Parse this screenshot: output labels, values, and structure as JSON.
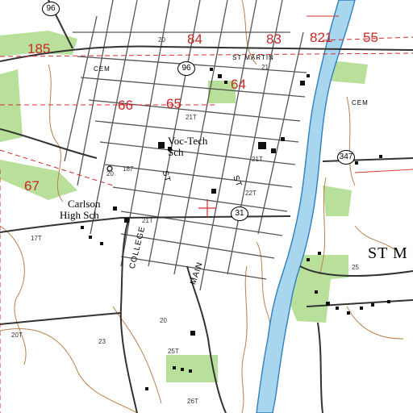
{
  "map": {
    "labels": {
      "voc_tech": "Voc-Tech",
      "voc_tech_sch": "Sch",
      "carlson": "Carlson",
      "carlson_high": "High Sch",
      "st_martin": "ST MARTIN",
      "parish": "ST M",
      "cem1": "CEM",
      "cem2": "CEM",
      "st1": "ST",
      "st2": "ST",
      "college": "COLLEGE",
      "main": "MAIN"
    },
    "sections": [
      "185",
      "84",
      "83",
      "821",
      "55",
      "64",
      "66",
      "65",
      "67"
    ],
    "routes": [
      "96",
      "96",
      "31",
      "347"
    ],
    "elevations": [
      "20",
      "21",
      "20",
      "21T",
      "22T",
      "21T",
      "21T",
      "17T",
      "20T",
      "23",
      "25T",
      "25",
      "20",
      "187",
      "26T"
    ],
    "colors": {
      "water": "#a7d6ee",
      "water_edge": "#2f7fc0",
      "vegetation": "#b9e09a",
      "section_line": "#d32f2f",
      "road": "#555555",
      "contour": "#b8824a"
    }
  }
}
